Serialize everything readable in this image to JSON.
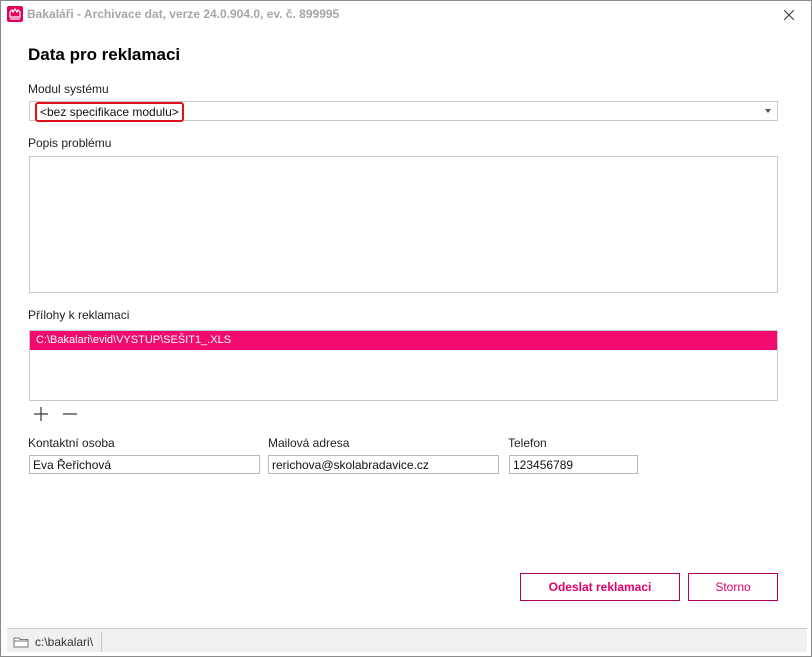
{
  "window": {
    "title": "Bakaláři - Archivace dat, verze 24.0.904.0, ev. č. 899995",
    "close_glyph": "✕"
  },
  "form": {
    "heading": "Data pro reklamaci",
    "module_label": "Modul systému",
    "module_value": "<bez specifikace modulu>",
    "description_label": "Popis problému",
    "description_value": "",
    "attachments_label": "Přílohy k reklamaci",
    "attachments": [
      {
        "path": "C:\\Bakalari\\evid\\VYSTUP\\SEŠIT1_.XLS",
        "selected": true
      }
    ],
    "contact_label": "Kontaktní osoba",
    "contact_value": "Eva Řeřichová",
    "email_label": "Mailová adresa",
    "email_value": "rerichova@skolabradavice.cz",
    "phone_label": "Telefon",
    "phone_value": "123456789",
    "submit_label": "Odeslat reklamaci",
    "cancel_label": "Storno"
  },
  "statusbar": {
    "path": "c:\\bakalari\\"
  },
  "colors": {
    "accent": "#e5005a",
    "selection": "#f20a6e",
    "highlight_border": "#e0101a"
  }
}
